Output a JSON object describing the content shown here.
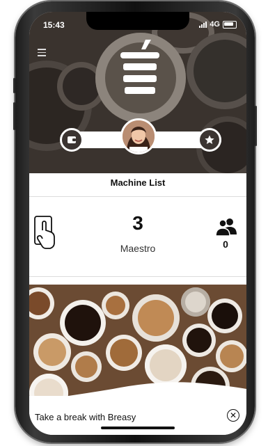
{
  "status_bar": {
    "time": "15:43",
    "network": "4G"
  },
  "header": {
    "title": "Machine List"
  },
  "stats": {
    "count": "3",
    "rank": "Maestro",
    "users": "0"
  },
  "banner": {
    "caption": "Take a break with Breasy",
    "close_symbol": "✕"
  },
  "icons": [
    "menu-icon",
    "cup-logo-icon",
    "wallet-icon",
    "star-icon",
    "tap-phone-icon",
    "users-icon",
    "close-icon"
  ]
}
